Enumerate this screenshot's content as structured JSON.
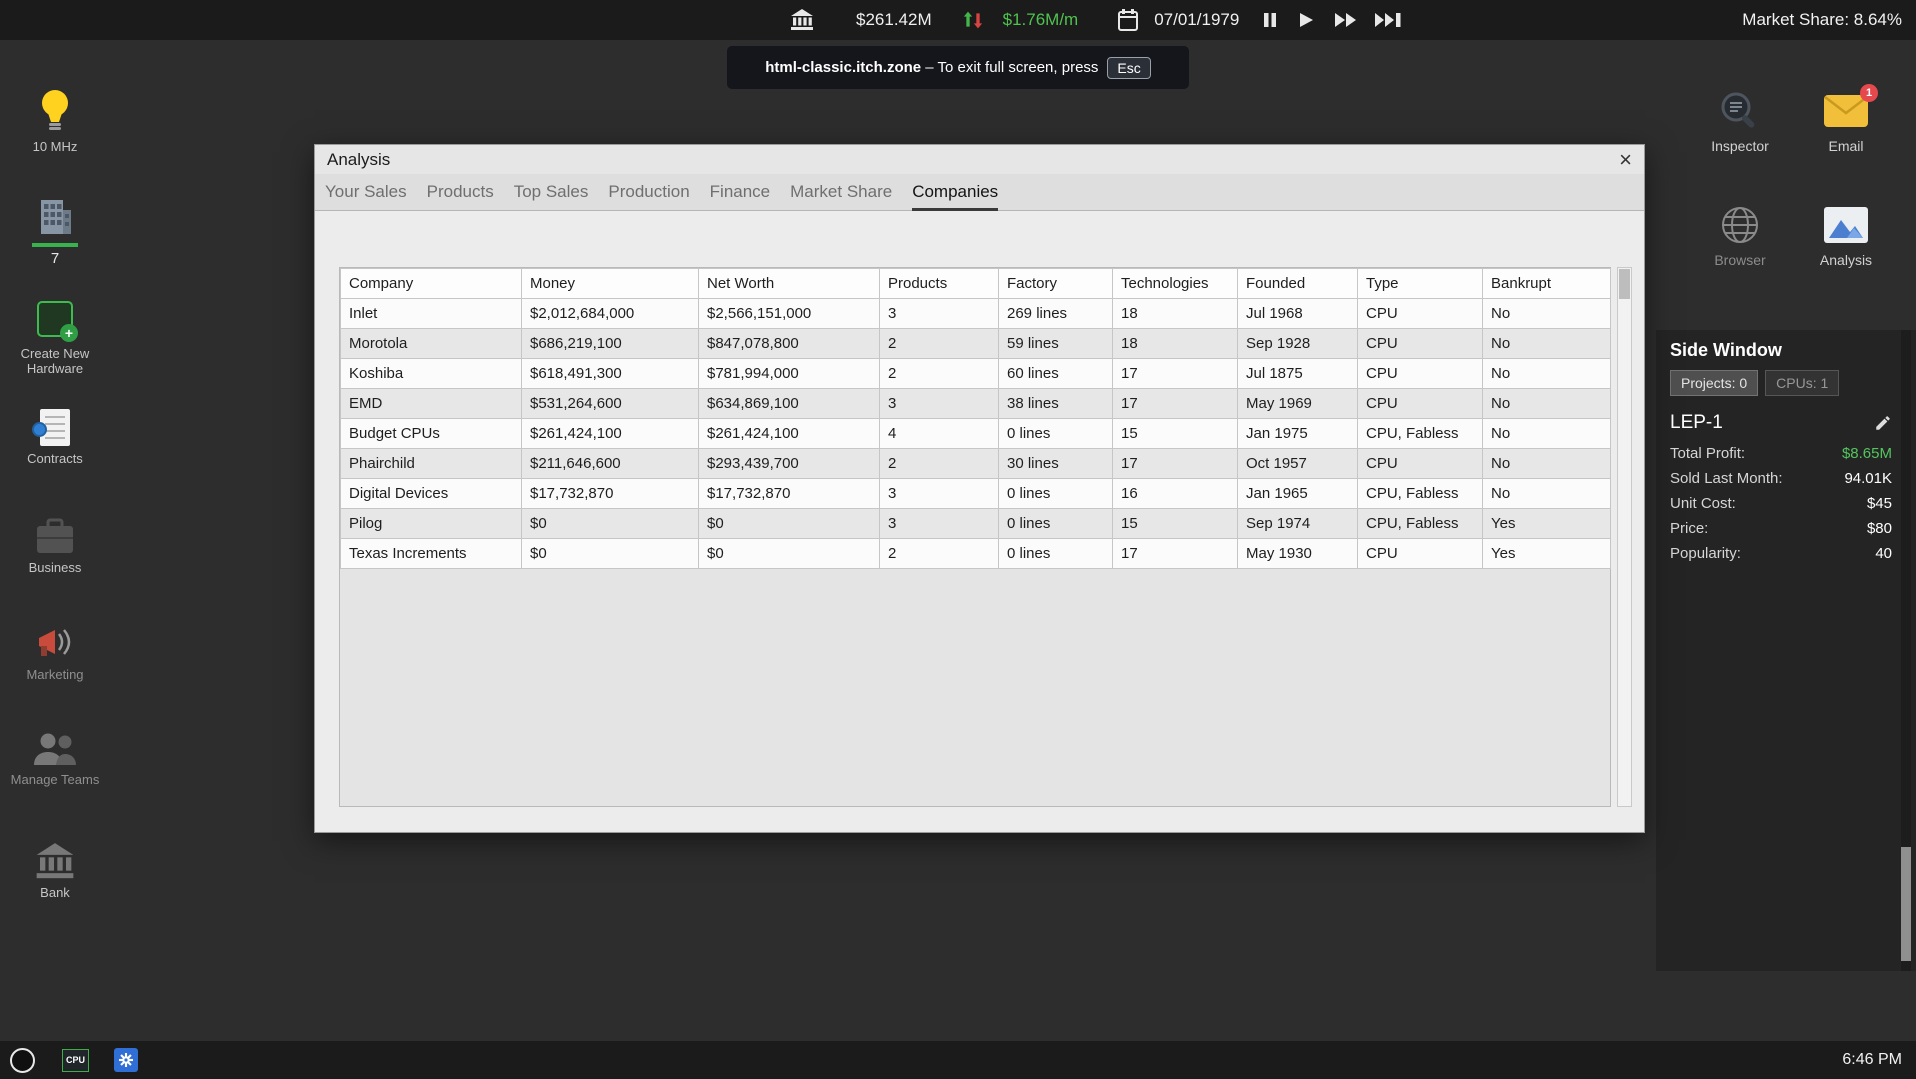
{
  "colors": {
    "money_green": "#4fc24f",
    "profit_green": "#54c45e",
    "alert_red": "#e5484d",
    "active_tab_underline": "#3a3a3a",
    "bulb_yellow": "#ffd21f",
    "hardware_green": "#3dbb4e"
  },
  "icons": {
    "close": "×",
    "plus": "+"
  },
  "topbar": {
    "money": "$261.42M",
    "income_per_month": "$1.76M/m",
    "date": "07/01/1979",
    "market_share": "Market Share: 8.64%"
  },
  "fullscreen_notice": {
    "domain": "html-classic.itch.zone",
    "message": "– To exit full screen, press",
    "key": "Esc"
  },
  "sidebar": {
    "items": [
      {
        "label": "10 MHz"
      },
      {
        "label": "7"
      },
      {
        "label": "Create New Hardware"
      },
      {
        "label": "Contracts"
      },
      {
        "label": "Business"
      },
      {
        "label": "Marketing"
      },
      {
        "label": "Manage Teams"
      },
      {
        "label": "Bank"
      }
    ]
  },
  "analysis_window": {
    "title": "Analysis",
    "active_tab": "Companies",
    "tabs": [
      {
        "label": "Your Sales"
      },
      {
        "label": "Products"
      },
      {
        "label": "Top Sales"
      },
      {
        "label": "Production"
      },
      {
        "label": "Finance"
      },
      {
        "label": "Market Share"
      },
      {
        "label": "Companies"
      }
    ],
    "table": {
      "columns": [
        "Company",
        "Money",
        "Net Worth",
        "Products",
        "Factory",
        "Technologies",
        "Founded",
        "Type",
        "Bankrupt"
      ],
      "rows": [
        [
          "Inlet",
          "$2,012,684,000",
          "$2,566,151,000",
          "3",
          "269 lines",
          "18",
          "Jul 1968",
          "CPU",
          "No"
        ],
        [
          "Morotola",
          "$686,219,100",
          "$847,078,800",
          "2",
          "59 lines",
          "18",
          "Sep 1928",
          "CPU",
          "No"
        ],
        [
          "Koshiba",
          "$618,491,300",
          "$781,994,000",
          "2",
          "60 lines",
          "17",
          "Jul 1875",
          "CPU",
          "No"
        ],
        [
          "EMD",
          "$531,264,600",
          "$634,869,100",
          "3",
          "38 lines",
          "17",
          "May 1969",
          "CPU",
          "No"
        ],
        [
          "Budget CPUs",
          "$261,424,100",
          "$261,424,100",
          "4",
          "0 lines",
          "15",
          "Jan 1975",
          "CPU, Fabless",
          "No"
        ],
        [
          "Phairchild",
          "$211,646,600",
          "$293,439,700",
          "2",
          "30 lines",
          "17",
          "Oct 1957",
          "CPU",
          "No"
        ],
        [
          "Digital Devices",
          "$17,732,870",
          "$17,732,870",
          "3",
          "0 lines",
          "16",
          "Jan 1965",
          "CPU, Fabless",
          "No"
        ],
        [
          "Pilog",
          "$0",
          "$0",
          "3",
          "0 lines",
          "15",
          "Sep 1974",
          "CPU, Fabless",
          "Yes"
        ],
        [
          "Texas Increments",
          "$0",
          "$0",
          "2",
          "0 lines",
          "17",
          "May 1930",
          "CPU",
          "Yes"
        ]
      ]
    }
  },
  "desktop_icons": {
    "inspector": {
      "label": "Inspector"
    },
    "email": {
      "label": "Email",
      "badge": "1"
    },
    "browser": {
      "label": "Browser"
    },
    "analysis": {
      "label": "Analysis"
    }
  },
  "side_window": {
    "title": "Side Window",
    "projects_button": "Projects: 0",
    "cpus_button": "CPUs: 1",
    "product": {
      "name": "LEP-1",
      "stats": [
        {
          "label": "Total Profit:",
          "value": "$8.65M"
        },
        {
          "label": "Sold Last Month:",
          "value": "94.01K"
        },
        {
          "label": "Unit Cost:",
          "value": "$45"
        },
        {
          "label": "Price:",
          "value": "$80"
        },
        {
          "label": "Popularity:",
          "value": "40"
        }
      ]
    }
  },
  "taskbar": {
    "cpu_badge": "CPU",
    "time": "6:46 PM"
  }
}
